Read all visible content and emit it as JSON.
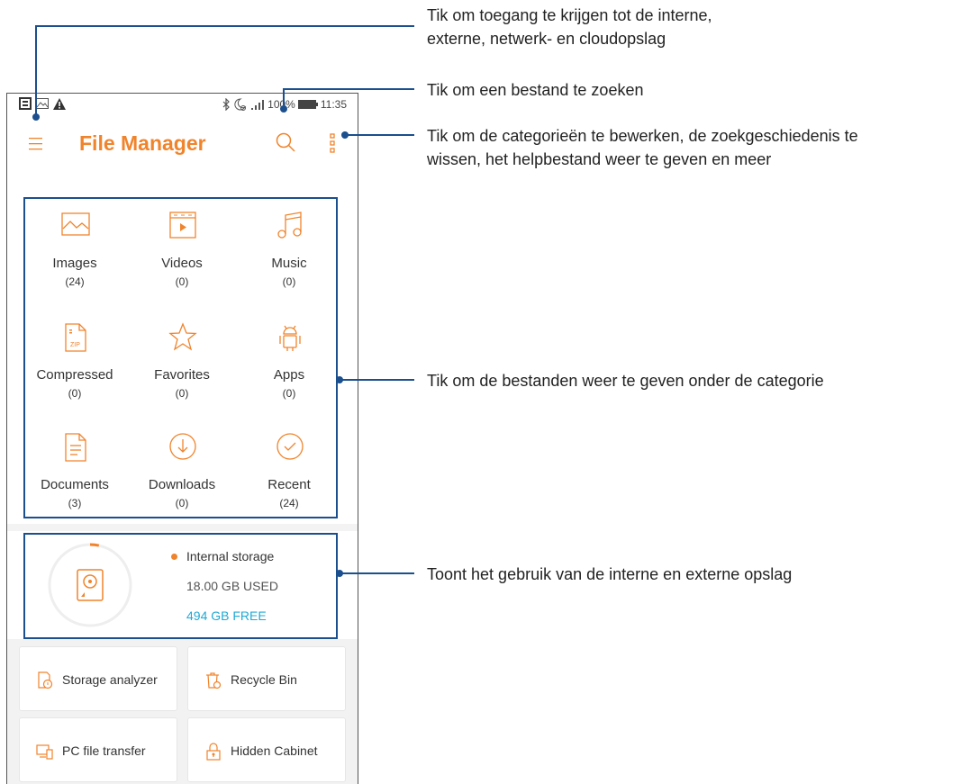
{
  "status_bar": {
    "battery": "100%",
    "time": "11:35"
  },
  "app_bar": {
    "title": "File Manager"
  },
  "categories": [
    {
      "name": "Images",
      "count": "(24)",
      "icon": "image-icon"
    },
    {
      "name": "Videos",
      "count": "(0)",
      "icon": "video-icon"
    },
    {
      "name": "Music",
      "count": "(0)",
      "icon": "music-icon"
    },
    {
      "name": "Compressed",
      "count": "(0)",
      "icon": "zip-file-icon"
    },
    {
      "name": "Favorites",
      "count": "(0)",
      "icon": "star-icon"
    },
    {
      "name": "Apps",
      "count": "(0)",
      "icon": "android-icon"
    },
    {
      "name": "Documents",
      "count": "(3)",
      "icon": "document-icon"
    },
    {
      "name": "Downloads",
      "count": "(0)",
      "icon": "download-icon"
    },
    {
      "name": "Recent",
      "count": "(24)",
      "icon": "check-circle-icon"
    }
  ],
  "storage": {
    "label": "Internal storage",
    "used": "18.00 GB USED",
    "free": "494 GB FREE",
    "used_fraction": 0.035
  },
  "tools": [
    {
      "label": "Storage analyzer",
      "icon": "storage-analyzer-icon"
    },
    {
      "label": "Recycle Bin",
      "icon": "recycle-bin-icon"
    },
    {
      "label": "PC file transfer",
      "icon": "pc-transfer-icon"
    },
    {
      "label": "Hidden Cabinet",
      "icon": "lock-icon"
    }
  ],
  "annotations": {
    "menu_line1": "Tik om toegang te krijgen tot de interne,",
    "menu_line2": "externe, netwerk- en cloudopslag",
    "search": "Tik om een bestand te zoeken",
    "more_line1": "Tik om de categorieën te bewerken, de zoekgeschiedenis te",
    "more_line2": "wissen, het helpbestand weer te geven en meer",
    "categories": "Tik om de bestanden weer te geven onder de categorie",
    "storage": "Toont het gebruik van de interne en externe opslag"
  },
  "colors": {
    "accent": "#f0842c",
    "free_text": "#1fa9d6",
    "callout": "#1b4f8e"
  }
}
